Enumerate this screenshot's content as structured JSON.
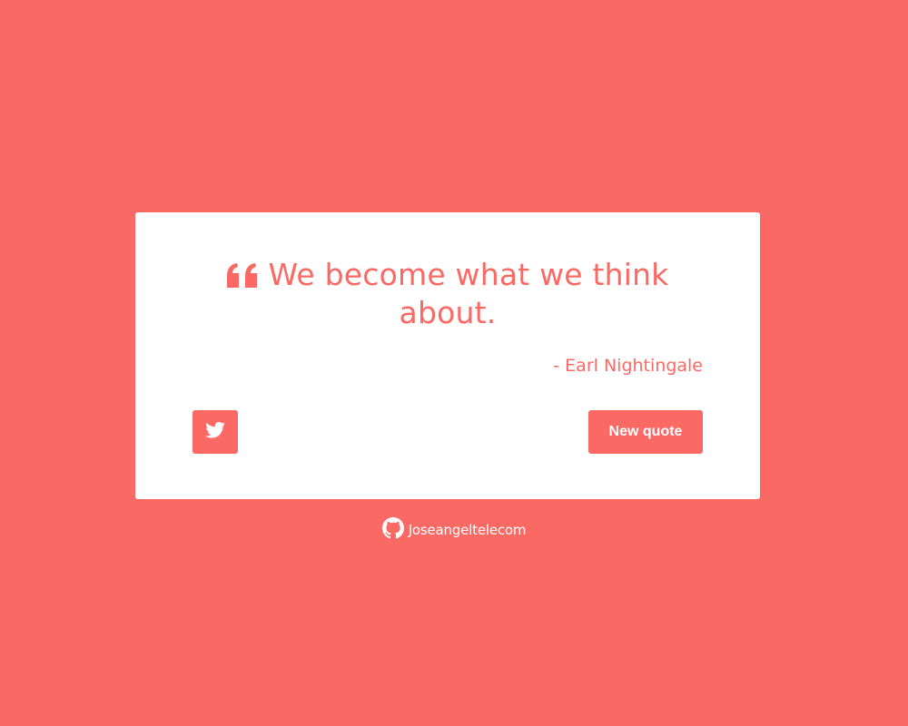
{
  "quote": {
    "text": "We become what we think about.",
    "author": "- Earl Nightingale"
  },
  "buttons": {
    "tweet_icon": "twitter-icon",
    "new_quote_label": "New quote"
  },
  "footer": {
    "icon": "github-icon",
    "link_text": "Joseangeltelecom"
  },
  "colors": {
    "accent": "#fb6964",
    "card": "#ffffff"
  }
}
